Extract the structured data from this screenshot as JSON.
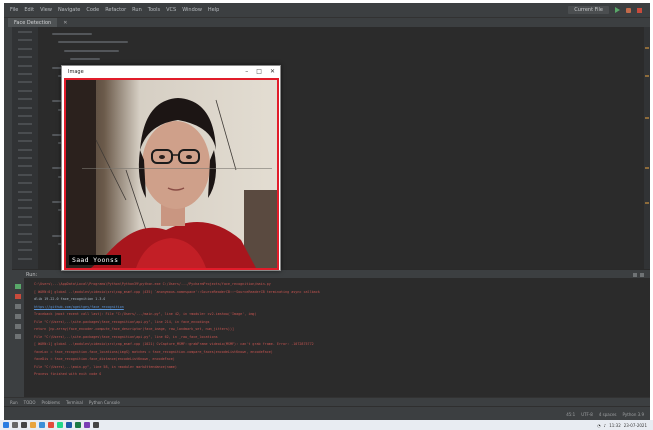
{
  "menu": {
    "items": [
      "File",
      "Edit",
      "View",
      "Navigate",
      "Code",
      "Refactor",
      "Run",
      "Tools",
      "VCS",
      "Window",
      "Help"
    ]
  },
  "toolbar": {
    "run_config": "Current File"
  },
  "editor": {
    "file_tab": "Face Detection"
  },
  "camera_window": {
    "title": "Image",
    "minimize": "–",
    "maximize": "□",
    "close": "✕",
    "label": "Saad Yoonss",
    "border_color": "#e11c2a"
  },
  "run_panel": {
    "title": "Run:"
  },
  "console": {
    "lines": [
      {
        "kind": "err",
        "text": "C:\\Users\\...\\AppData\\Local\\Programs\\Python\\Python39\\python.exe C:/Users/.../PycharmProjects/face_recognition/main.py"
      },
      {
        "kind": "err",
        "text": "[ WARN:0] global ..\\modules\\videoio\\src\\cap_msmf.cpp (435) `anonymous-namespace'::SourceReaderCB::~SourceReaderCB terminating async callback"
      },
      {
        "kind": "norm",
        "text": "dlib 19.22.0  face_recognition 1.3.0"
      },
      {
        "kind": "lnk",
        "text": "https://github.com/ageitgey/face_recognition"
      },
      {
        "kind": "err",
        "text": "Traceback (most recent call last):  File \"C:/Users/.../main.py\", line 42, in <module>  cv2.imshow('Image', img)"
      },
      {
        "kind": "err",
        "text": "  File \"C:\\Users\\...\\site-packages\\face_recognition\\api.py\", line 214, in face_encodings"
      },
      {
        "kind": "err",
        "text": "    return [np.array(face_encoder.compute_face_descriptor(face_image, raw_landmark_set, num_jitters))]"
      },
      {
        "kind": "err",
        "text": "  File \"C:\\Users\\...\\site-packages\\face_recognition\\api.py\", line 62, in _raw_face_locations"
      },
      {
        "kind": "err",
        "text": "[ WARN:1] global ..\\modules\\videoio\\src\\cap_msmf.cpp (1021) CvCapture_MSMF::grabFrame videoio(MSMF): can't grab frame. Error: -1072875772"
      },
      {
        "kind": "err",
        "text": "    faceLoc = face_recognition.face_locations(imgS)  matches = face_recognition.compare_faces(encodeListKnown, encodeFace)"
      },
      {
        "kind": "err",
        "text": "    faceDis = face_recognition.face_distance(encodeListKnown, encodeFace)"
      },
      {
        "kind": "err",
        "text": "  File \"C:\\Users\\...\\main.py\", line 58, in <module>  markAttendance(name)"
      },
      {
        "kind": "err",
        "text": "Process finished with exit code 0"
      }
    ]
  },
  "bottom_tabs": [
    "Run",
    "TODO",
    "Problems",
    "Terminal",
    "Python Console"
  ],
  "status": {
    "position": "45:1",
    "encoding": "UTF-8",
    "indent": "4 spaces",
    "interpreter": "Python 3.9"
  },
  "taskbar": {
    "time": "11:32",
    "date": "23-07-2021"
  }
}
